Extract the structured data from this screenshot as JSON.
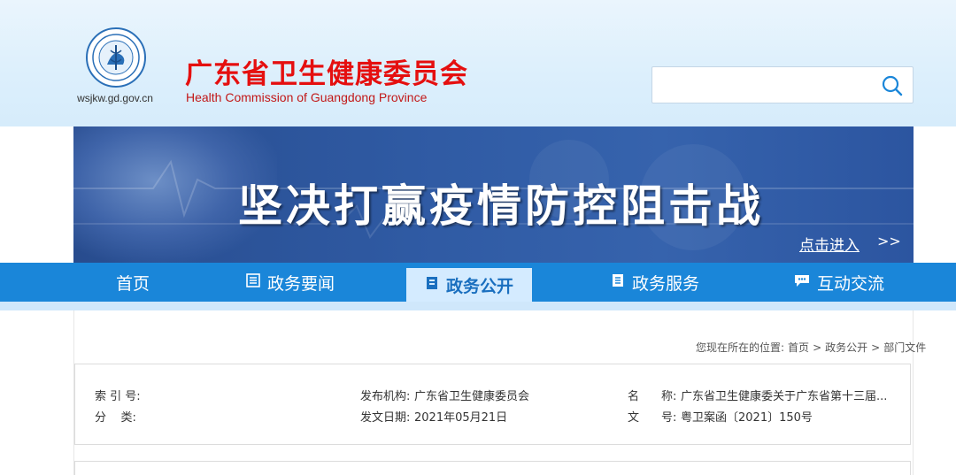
{
  "header": {
    "site_url": "wsjkw.gd.gov.cn",
    "title_cn": "广东省卫生健康委员会",
    "title_en": "Health Commission of Guangdong Province",
    "search": {
      "placeholder": "",
      "icon": "search-icon"
    }
  },
  "banner": {
    "slogan": "坚决打赢疫情防控阻击战",
    "link_label": "点击进入",
    "link_arrows": ">>"
  },
  "nav": {
    "items": [
      {
        "label": "首页",
        "icon": ""
      },
      {
        "label": "政务要闻",
        "icon": "news-icon"
      },
      {
        "label": "政务公开",
        "icon": "document-icon"
      },
      {
        "label": "政务服务",
        "icon": "service-icon"
      },
      {
        "label": "互动交流",
        "icon": "chat-icon"
      }
    ],
    "active_index": 2
  },
  "breadcrumb": {
    "prefix": "您现在所在的位置:",
    "items": [
      "首页",
      "政务公开",
      "部门文件"
    ],
    "separator": ">"
  },
  "doc_info": {
    "index_label": "索 引 号:",
    "index_value": "",
    "category_label": "分    类:",
    "category_value": "",
    "publisher_label": "发布机构:",
    "publisher_value": "广东省卫生健康委员会",
    "date_label": "发文日期:",
    "date_value": "2021年05月21日",
    "name_label_a": "名",
    "name_label_b": "称:",
    "name_value": "广东省卫生健康委关于广东省第十三届...",
    "docno_label_a": "文",
    "docno_label_b": "号:",
    "docno_value": "粤卫案函〔2021〕150号"
  },
  "colors": {
    "title_red": "#e50f0f",
    "nav_blue": "#1a86d9",
    "nav_active_bg": "#d4ebff",
    "banner_blue": "#2f5aa3"
  }
}
